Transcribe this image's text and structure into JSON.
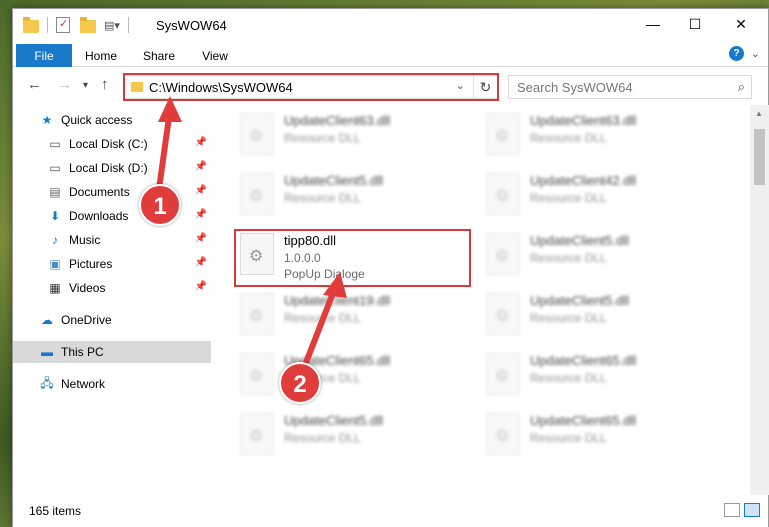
{
  "window": {
    "title": "SysWOW64",
    "controls": {
      "minimize": "—",
      "maximize": "☐",
      "close": "✕"
    }
  },
  "ribbon": {
    "tabs": [
      "File",
      "Home",
      "Share",
      "View"
    ]
  },
  "nav": {
    "address": "C:\\Windows\\SysWOW64",
    "search_placeholder": "Search SysWOW64"
  },
  "sidebar": {
    "items": [
      {
        "label": "Quick access",
        "icon": "star-icon"
      },
      {
        "label": "Local Disk (C:)",
        "icon": "drive-icon",
        "pinned": true
      },
      {
        "label": "Local Disk (D:)",
        "icon": "drive-icon",
        "pinned": true
      },
      {
        "label": "Documents",
        "icon": "document-icon",
        "pinned": true
      },
      {
        "label": "Downloads",
        "icon": "download-icon",
        "pinned": true
      },
      {
        "label": "Music",
        "icon": "music-icon",
        "pinned": true
      },
      {
        "label": "Pictures",
        "icon": "picture-icon",
        "pinned": true
      },
      {
        "label": "Videos",
        "icon": "video-icon",
        "pinned": true
      },
      {
        "label": "OneDrive",
        "icon": "cloud-icon"
      },
      {
        "label": "This PC",
        "icon": "computer-icon",
        "selected": true
      },
      {
        "label": "Network",
        "icon": "network-icon"
      }
    ]
  },
  "files": [
    {
      "name": "UpdateClient63.dll",
      "line2": "Resource DLL",
      "line3": "",
      "blurred": true
    },
    {
      "name": "UpdateClient63.dll",
      "line2": "Resource DLL",
      "line3": "",
      "blurred": true
    },
    {
      "name": "UpdateClient5.dll",
      "line2": "Resource DLL",
      "line3": "",
      "blurred": true
    },
    {
      "name": "UpdateClient42.dll",
      "line2": "Resource DLL",
      "line3": "",
      "blurred": true
    },
    {
      "name": "tipp80.dll",
      "line2": "1.0.0.0",
      "line3": "PopUp Dialoge",
      "blurred": false
    },
    {
      "name": "UpdateClient5.dll",
      "line2": "Resource DLL",
      "line3": "",
      "blurred": true
    },
    {
      "name": "UpdateClient19.dll",
      "line2": "Resource DLL",
      "line3": "",
      "blurred": true
    },
    {
      "name": "UpdateClient5.dll",
      "line2": "Resource DLL",
      "line3": "",
      "blurred": true
    },
    {
      "name": "UpdateClient65.dll",
      "line2": "Resource DLL",
      "line3": "",
      "blurred": true
    },
    {
      "name": "UpdateClient65.dll",
      "line2": "Resource DLL",
      "line3": "",
      "blurred": true
    },
    {
      "name": "UpdateClient5.dll",
      "line2": "Resource DLL",
      "line3": "",
      "blurred": true
    },
    {
      "name": "UpdateClient65.dll",
      "line2": "Resource DLL",
      "line3": "",
      "blurred": true
    }
  ],
  "status": {
    "item_count": "165 items"
  },
  "annotations": {
    "step1": "1",
    "step2": "2",
    "highlight_color": "#d63a3a"
  },
  "colors": {
    "accent": "#1979ca",
    "selection": "#d9d9d9"
  }
}
